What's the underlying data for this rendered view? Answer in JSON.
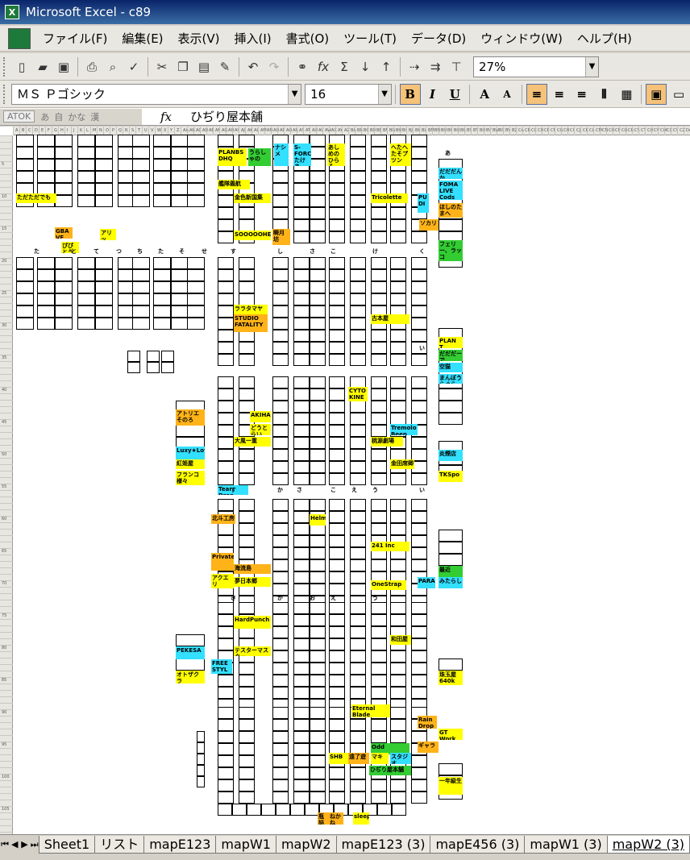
{
  "window": {
    "title": "Microsoft Excel - c89"
  },
  "menu": [
    "ファイル(F)",
    "編集(E)",
    "表示(V)",
    "挿入(I)",
    "書式(O)",
    "ツール(T)",
    "データ(D)",
    "ウィンドウ(W)",
    "ヘルプ(H)"
  ],
  "toolbar": {
    "zoom": "27%"
  },
  "format": {
    "font": "ＭＳ Ｐゴシック",
    "size": "16"
  },
  "ime": {
    "name": "ATOK",
    "modes": [
      "あ",
      "自",
      "かな",
      "漢"
    ]
  },
  "formula": {
    "value": "ひぢり屋本舗"
  },
  "tabs": [
    "Sheet1",
    "リスト",
    "mapE123",
    "mapW1",
    "mapW2",
    "mapE123 (3)",
    "mapE456 (3)",
    "mapW1 (3)",
    "mapW2 (3)"
  ],
  "active_tab": "mapW2 (3)",
  "map": {
    "block_headers": [
      "あ",
      "た",
      "と",
      "て",
      "つ",
      "ち",
      "た",
      "そ",
      "せ",
      "す",
      "し",
      "さ",
      "こ",
      "け",
      "く",
      "い",
      "す",
      "か",
      "さ",
      "こ",
      "え",
      "う",
      "い",
      "き",
      "か",
      "お",
      "え",
      "う"
    ],
    "labels": [
      {
        "t": "ただただでも",
        "c": "y"
      },
      {
        "t": "GBA VE",
        "c": "o"
      },
      {
        "t": "ぴぴとうぶ",
        "c": "y"
      },
      {
        "t": "アリッ",
        "c": "y"
      },
      {
        "t": "PLANBS DHQ",
        "c": "y"
      },
      {
        "t": "うらしゃの",
        "c": "g"
      },
      {
        "t": "ナシメ",
        "c": "cy"
      },
      {
        "t": "S-FORCE たけま",
        "c": "cy"
      },
      {
        "t": "あしめのひらそ",
        "c": "y"
      },
      {
        "t": "へたへたそプツン",
        "c": "y"
      },
      {
        "t": "だだだんか",
        "c": "cy"
      },
      {
        "t": "FOMA LIVE Cods",
        "c": "cy"
      },
      {
        "t": "ほしのたまへ",
        "c": "o"
      },
      {
        "t": "ソカリ",
        "c": "o"
      },
      {
        "t": "フェリー、ラッコ",
        "c": "g"
      },
      {
        "t": "艦隊義航",
        "c": "y"
      },
      {
        "t": "金色新国集",
        "c": "y"
      },
      {
        "t": "Tricolette",
        "c": "y"
      },
      {
        "t": "PU DI",
        "c": "cy"
      },
      {
        "t": "SOOOOOHE",
        "c": "y"
      },
      {
        "t": "瞬月坊",
        "c": "o"
      },
      {
        "t": "ララタマヤ",
        "c": "y"
      },
      {
        "t": "STUDIO FATALITY",
        "c": "o"
      },
      {
        "t": "古本屋",
        "c": "y"
      },
      {
        "t": "PLAN T",
        "c": "y"
      },
      {
        "t": "だだだーで",
        "c": "g"
      },
      {
        "t": "空猫",
        "c": "cy"
      },
      {
        "t": "まんぼうらぐら",
        "c": "cy"
      },
      {
        "t": "アトリエそのろ",
        "c": "o"
      },
      {
        "t": "AKIHA",
        "c": "y"
      },
      {
        "t": "どうとらい",
        "c": "y"
      },
      {
        "t": "大風一重",
        "c": "y"
      },
      {
        "t": "CYTO KINE",
        "c": "y"
      },
      {
        "t": "Tremolo Beep",
        "c": "cy"
      },
      {
        "t": "Luxy★Love",
        "c": "cy"
      },
      {
        "t": "紅姫屋",
        "c": "y"
      },
      {
        "t": "フランコ様々",
        "c": "y"
      },
      {
        "t": "桃源劇場",
        "c": "y"
      },
      {
        "t": "金田席卿",
        "c": "y"
      },
      {
        "t": "炎煙店",
        "c": "cy"
      },
      {
        "t": "TKSpo",
        "c": "y"
      },
      {
        "t": "Tear Drop",
        "c": "cy"
      },
      {
        "t": "北斗工房",
        "c": "o"
      },
      {
        "t": "Helm",
        "c": "y"
      },
      {
        "t": "241 Inc",
        "c": "y"
      },
      {
        "t": "PrivatePink",
        "c": "o"
      },
      {
        "t": "海流島",
        "c": "o"
      },
      {
        "t": "アクエリ",
        "c": "y"
      },
      {
        "t": "夢日本郷",
        "c": "y"
      },
      {
        "t": "OneStrap",
        "c": "y"
      },
      {
        "t": "PARADOX",
        "c": "cy"
      },
      {
        "t": "最近",
        "c": "g"
      },
      {
        "t": "みたらし",
        "c": "cy"
      },
      {
        "t": "HardPunch",
        "c": "y"
      },
      {
        "t": "テスターマスター",
        "c": "y"
      },
      {
        "t": "和田屋",
        "c": "y"
      },
      {
        "t": "PEKESA",
        "c": "cy"
      },
      {
        "t": "FREE STYL",
        "c": "cy"
      },
      {
        "t": "オトザクラ",
        "c": "y"
      },
      {
        "t": "珠玉屋 640k",
        "c": "y"
      },
      {
        "t": "Eternal Blade",
        "c": "y"
      },
      {
        "t": "Rain Drop",
        "c": "o"
      },
      {
        "t": "GT Work",
        "c": "y"
      },
      {
        "t": "Odd",
        "c": "g"
      },
      {
        "t": "ギャラ",
        "c": "o"
      },
      {
        "t": "マキ",
        "c": "y"
      },
      {
        "t": "スタジオ",
        "c": "cy"
      },
      {
        "t": "SHB",
        "c": "y"
      },
      {
        "t": "遠了遊",
        "c": "o"
      },
      {
        "t": "ひぢり屋本舗",
        "c": "g"
      },
      {
        "t": "一年級生",
        "c": "y"
      },
      {
        "t": "瓶詰",
        "c": "o"
      },
      {
        "t": "ねかね",
        "c": "o"
      },
      {
        "t": "sleep",
        "c": "y"
      }
    ]
  }
}
